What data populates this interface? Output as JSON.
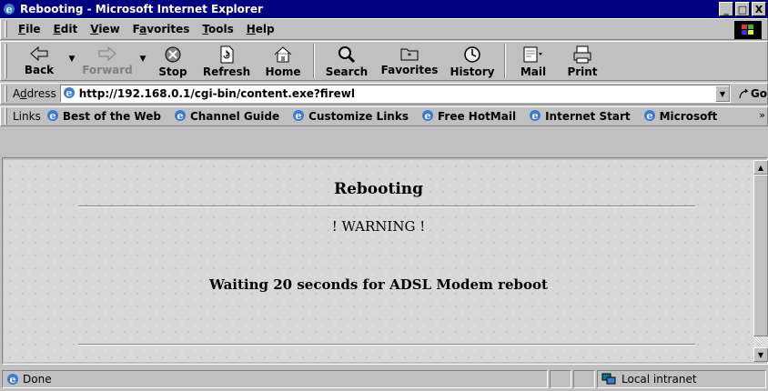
{
  "window": {
    "title": "Rebooting - Microsoft Internet Explorer",
    "buttons": {
      "minimize": "_",
      "maximize": "□",
      "close": "X"
    }
  },
  "menu": [
    {
      "pre": "",
      "ul": "F",
      "post": "ile"
    },
    {
      "pre": "",
      "ul": "E",
      "post": "dit"
    },
    {
      "pre": "",
      "ul": "V",
      "post": "iew"
    },
    {
      "pre": "F",
      "ul": "a",
      "post": "vorites"
    },
    {
      "pre": "",
      "ul": "T",
      "post": "ools"
    },
    {
      "pre": "",
      "ul": "H",
      "post": "elp"
    }
  ],
  "toolbar": {
    "back": "Back",
    "forward": "Forward",
    "stop": "Stop",
    "refresh": "Refresh",
    "home": "Home",
    "search": "Search",
    "favorites": "Favorites",
    "history": "History",
    "mail": "Mail",
    "print": "Print"
  },
  "address": {
    "label": "Address",
    "label_ul": "d",
    "url": "http://192.168.0.1/cgi-bin/content.exe?firewl",
    "go": "Go"
  },
  "links": {
    "label": "Links",
    "items": [
      "Best of the Web",
      "Channel Guide",
      "Customize Links",
      "Free HotMail",
      "Internet Start",
      "Microsoft"
    ],
    "more": "»"
  },
  "page": {
    "title": "Rebooting",
    "warning": "! WARNING !",
    "message": "Waiting 20 seconds for ADSL Modem reboot"
  },
  "status": {
    "text": "Done",
    "zone": "Local intranet"
  },
  "colors": {
    "titlebar": "#000080",
    "chrome": "#c0c0c0",
    "page_background": "#d8d8d8"
  }
}
